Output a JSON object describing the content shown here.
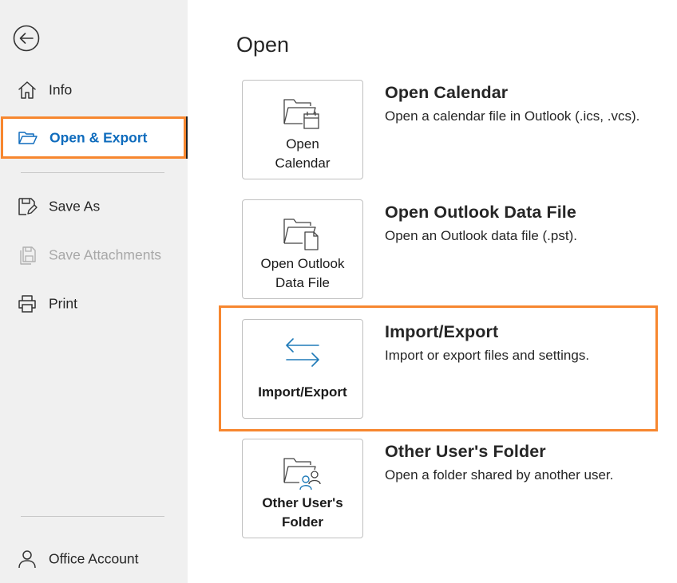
{
  "sidebar": {
    "back_icon": "back-arrow-icon",
    "items": [
      {
        "label": "Info",
        "icon": "home-icon"
      },
      {
        "label": "Open & Export",
        "icon": "folder-open-icon"
      },
      {
        "label": "Save As",
        "icon": "save-as-icon"
      },
      {
        "label": "Save Attachments",
        "icon": "save-attachments-icon"
      },
      {
        "label": "Print",
        "icon": "printer-icon"
      },
      {
        "label": "Office Account",
        "icon": "person-icon"
      }
    ]
  },
  "main": {
    "title": "Open",
    "options": [
      {
        "tile_line1": "Open",
        "tile_line2": "Calendar",
        "title": "Open Calendar",
        "description": "Open a calendar file in Outlook (.ics, .vcs).",
        "icon": "calendar-folder-icon"
      },
      {
        "tile_line1": "Open Outlook",
        "tile_line2": "Data File",
        "title": "Open Outlook Data File",
        "description": "Open an Outlook data file (.pst).",
        "icon": "data-file-folder-icon"
      },
      {
        "tile_line1": "Import/Export",
        "title": "Import/Export",
        "description": "Import or export files and settings.",
        "icon": "import-export-arrows-icon"
      },
      {
        "tile_line1": "Other User's",
        "tile_line2": "Folder",
        "title": "Other User's Folder",
        "description": "Open a folder shared by another user.",
        "icon": "shared-folder-icon"
      }
    ]
  },
  "colors": {
    "highlight": "#f7872f",
    "accent": "#0f6cbd",
    "sidebar_bg": "#f0f0f0",
    "disabled_text": "#a8a8a8"
  }
}
